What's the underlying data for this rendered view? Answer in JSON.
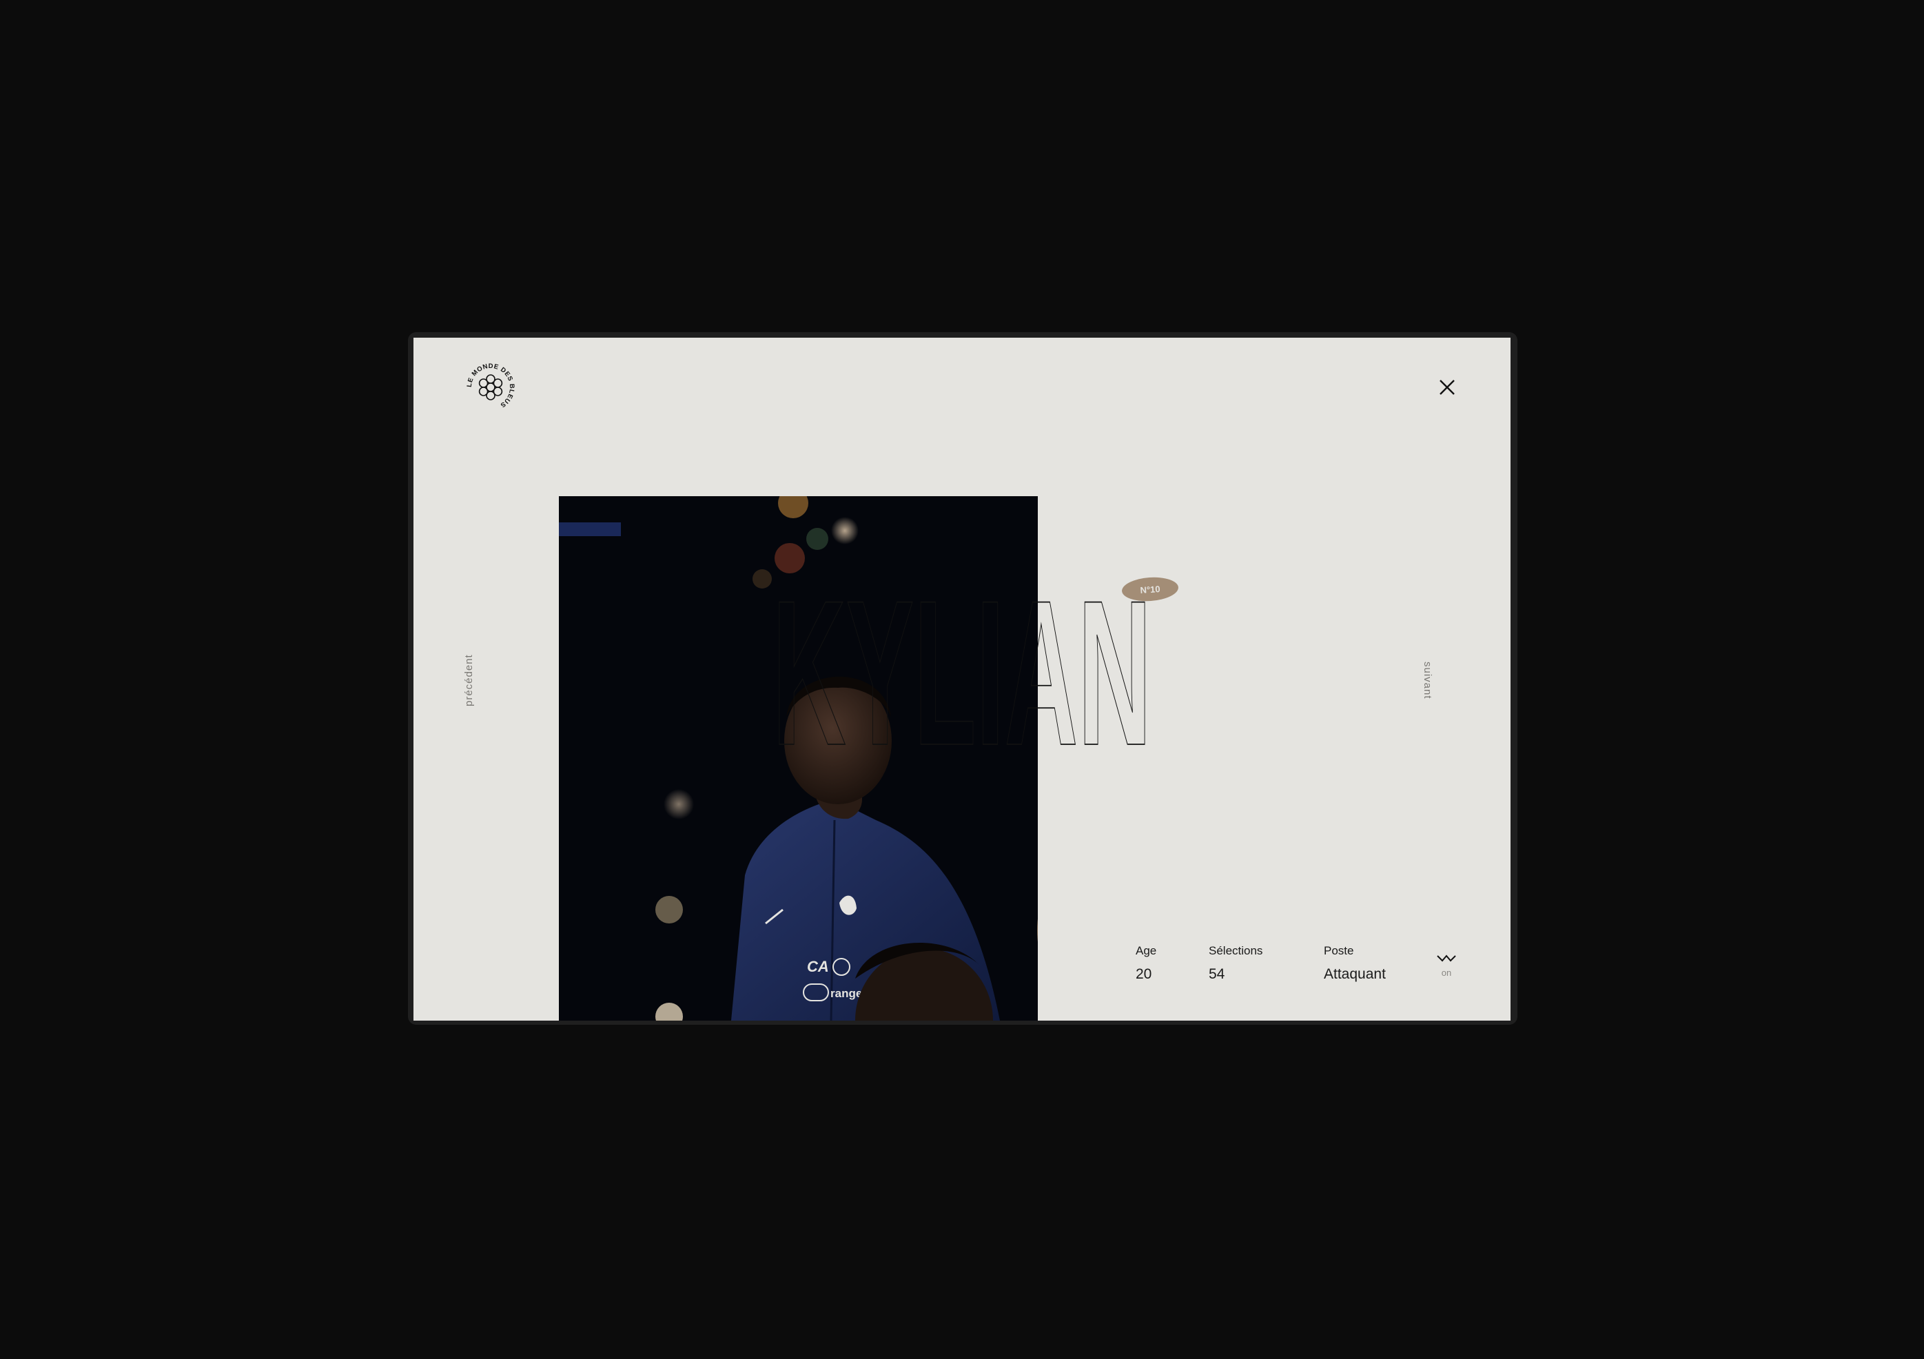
{
  "brand": {
    "logo_text": "LE MONDE DES BLEUS"
  },
  "nav": {
    "prev_label": "précédent",
    "next_label": "suivant"
  },
  "player": {
    "first_name": "KYLIAN",
    "number": "N°10"
  },
  "photo": {
    "description_icon": "player-photo"
  },
  "stats": [
    {
      "label": "Age",
      "value": "20"
    },
    {
      "label": "Sélections",
      "value": "54"
    },
    {
      "label": "Poste",
      "value": "Attaquant"
    }
  ],
  "toggle": {
    "state": "on"
  },
  "colors": {
    "background": "#0c0c0c",
    "panel": "#e5e4e0",
    "badge": "#a38d76",
    "ink": "#1a1a1a"
  }
}
